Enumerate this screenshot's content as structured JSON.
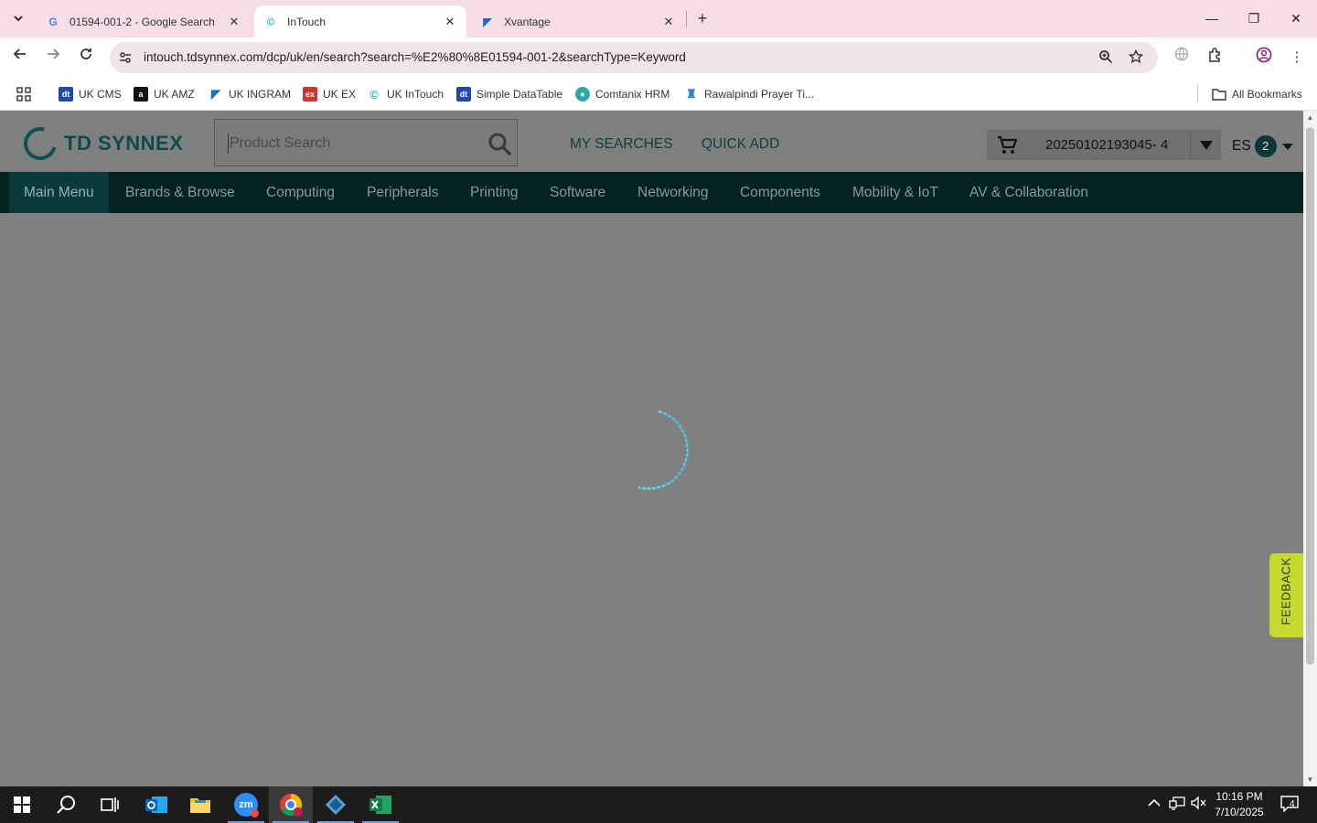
{
  "browser": {
    "tabs": [
      {
        "title": "01594-001-2 - Google Search",
        "favicon": "google-icon"
      },
      {
        "title": "InTouch",
        "favicon": "intouch-icon"
      },
      {
        "title": "Xvantage",
        "favicon": "xvantage-icon"
      }
    ],
    "url": "intouch.tdsynnex.com/dcp/uk/en/search?search=%E2%80%8E01594-001-2&searchType=Keyword"
  },
  "bookmarks": {
    "items": [
      {
        "label": "UK CMS",
        "color": "#1f4aa8"
      },
      {
        "label": "UK AMZ",
        "color": "#111111"
      },
      {
        "label": "UK INGRAM",
        "color": "#1b6fb5"
      },
      {
        "label": "UK EX",
        "color": "#d3342b"
      },
      {
        "label": "UK InTouch",
        "color": "#2aa9a9"
      },
      {
        "label": "Simple DataTable",
        "color": "#1f4aa8"
      },
      {
        "label": "Comtanix HRM",
        "color": "#2aa9a9"
      },
      {
        "label": "Rawalpindi Prayer Ti...",
        "color": "#2a7bd4"
      }
    ],
    "all_label": "All Bookmarks"
  },
  "site": {
    "logo_text": "TD SYNNEX",
    "search_placeholder": "Product Search",
    "my_searches": "MY SEARCHES",
    "quick_add": "QUICK ADD",
    "cart_ref": "20250102193045- 4",
    "user_initials": "ES",
    "user_badge": "2",
    "nav": [
      "Main Menu",
      "Brands & Browse",
      "Computing",
      "Peripherals",
      "Printing",
      "Software",
      "Networking",
      "Components",
      "Mobility & IoT",
      "AV & Collaboration"
    ],
    "feedback": "FEEDBACK"
  },
  "taskbar": {
    "time": "10:16 PM",
    "date": "7/10/2025",
    "notifications": "4"
  },
  "colors": {
    "accent": "#0d4a4e",
    "nav_bg": "#032221",
    "feedback_bg": "#c6d92e",
    "spinner": "#4fc3dc"
  }
}
